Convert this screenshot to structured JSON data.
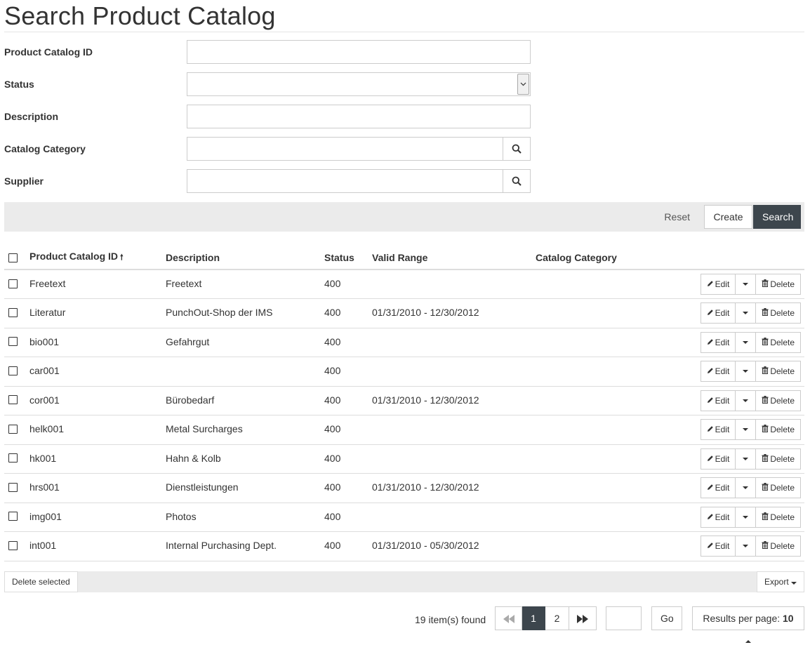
{
  "page": {
    "title": "Search Product Catalog"
  },
  "form": {
    "product_catalog_id": {
      "label": "Product Catalog ID",
      "value": ""
    },
    "status": {
      "label": "Status",
      "value": ""
    },
    "description": {
      "label": "Description",
      "value": ""
    },
    "catalog_category": {
      "label": "Catalog Category",
      "value": ""
    },
    "supplier": {
      "label": "Supplier",
      "value": ""
    }
  },
  "toolbar": {
    "reset_label": "Reset",
    "create_label": "Create",
    "search_label": "Search"
  },
  "table": {
    "headers": [
      "Product Catalog ID",
      "Description",
      "Status",
      "Valid Range",
      "Catalog Category"
    ],
    "sort_icon": "arrow-up-icon",
    "row_actions": {
      "edit_label": "Edit",
      "delete_label": "Delete"
    },
    "rows": [
      {
        "id": "Freetext",
        "description": "Freetext",
        "status": "400",
        "valid_range": "",
        "category": ""
      },
      {
        "id": "Literatur",
        "description": "PunchOut-Shop der IMS",
        "status": "400",
        "valid_range": "01/31/2010 - 12/30/2012",
        "category": ""
      },
      {
        "id": "bio001",
        "description": "Gefahrgut",
        "status": "400",
        "valid_range": "",
        "category": ""
      },
      {
        "id": "car001",
        "description": "",
        "status": "400",
        "valid_range": "",
        "category": ""
      },
      {
        "id": "cor001",
        "description": "Bürobedarf",
        "status": "400",
        "valid_range": "01/31/2010 - 12/30/2012",
        "category": ""
      },
      {
        "id": "helk001",
        "description": "Metal Surcharges",
        "status": "400",
        "valid_range": "",
        "category": ""
      },
      {
        "id": "hk001",
        "description": "Hahn & Kolb",
        "status": "400",
        "valid_range": "",
        "category": ""
      },
      {
        "id": "hrs001",
        "description": "Dienstleistungen",
        "status": "400",
        "valid_range": "01/31/2010 - 12/30/2012",
        "category": ""
      },
      {
        "id": "img001",
        "description": "Photos",
        "status": "400",
        "valid_range": "",
        "category": ""
      },
      {
        "id": "int001",
        "description": "Internal Purchasing Dept.",
        "status": "400",
        "valid_range": "01/31/2010 - 05/30/2012",
        "category": ""
      }
    ]
  },
  "footer": {
    "delete_selected_label": "Delete selected",
    "export_label": "Export"
  },
  "pagination": {
    "found_text": "19 item(s) found",
    "pages": [
      "1",
      "2"
    ],
    "current_page": "1",
    "page_input_value": "",
    "go_label": "Go",
    "results_per_page_label": "Results per page:",
    "results_per_page_value": "10"
  },
  "colors": {
    "accent_dark": "#3d464d",
    "toolbar_bg": "#ebebeb",
    "border": "#cccccc"
  }
}
